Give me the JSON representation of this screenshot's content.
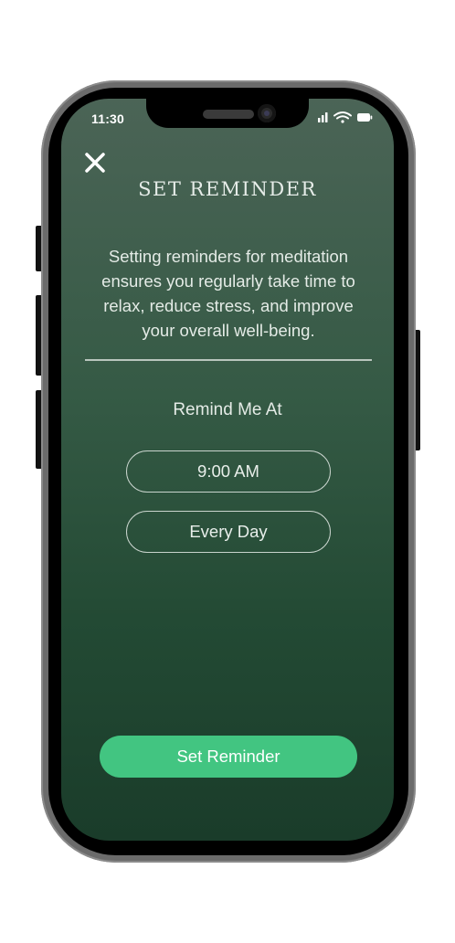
{
  "status_bar": {
    "time": "11:30",
    "icons": [
      "signal-icon",
      "wifi-icon",
      "battery-icon"
    ]
  },
  "header": {
    "close_icon": "close-icon",
    "title": "SET REMINDER"
  },
  "description": "Setting reminders for meditation ensures you regularly take time to relax, reduce stress, and improve your overall well-being.",
  "reminder": {
    "label": "Remind Me At",
    "time_value": "9:00 AM",
    "frequency_value": "Every Day"
  },
  "actions": {
    "submit_label": "Set Reminder"
  },
  "colors": {
    "accent": "#42c581",
    "background_top": "#4b6456",
    "background_bottom": "#1a3c2a",
    "text": "#e4ebe6"
  }
}
